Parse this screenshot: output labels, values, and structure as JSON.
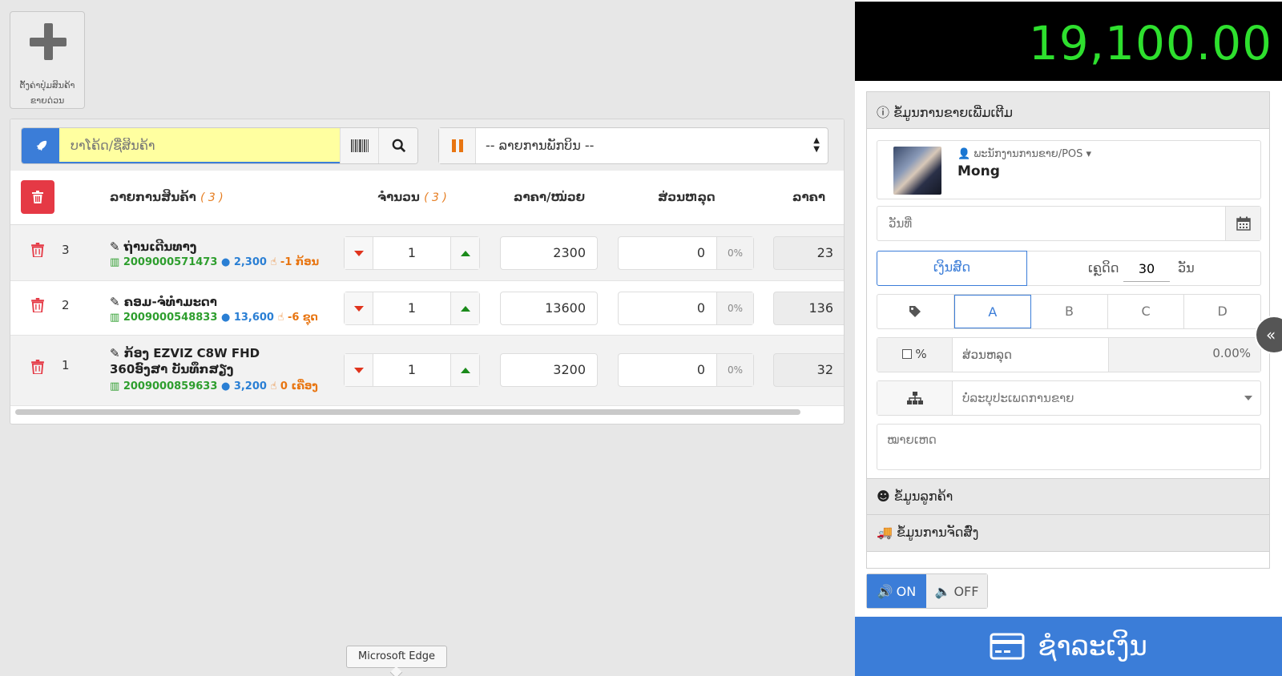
{
  "add_button": {
    "label": "ຕັ້ງຄ່າປຸ່ມສິນຄ້າຂາຍດ່ວນ"
  },
  "search": {
    "placeholder": "ບາໂຄ້ດ/ຊື່ສິນຄ້າ"
  },
  "hold": {
    "selected": "-- ລາຍການພັກບິນ --"
  },
  "table": {
    "headers": {
      "item": "ລາຍການສິນຄ້າ",
      "item_count": "( 3 )",
      "qty": "ຈຳນວນ",
      "qty_count": "( 3 )",
      "unit_price": "ລາຄາ/ໜ່ວຍ",
      "discount": "ສ່ວນຫລຸດ",
      "total": "ລາຄາ"
    },
    "rows": [
      {
        "index": "3",
        "name": "ຖ່ານເດີນທາງ",
        "barcode": "2009000571473",
        "price": "2,300",
        "stock": "-1 ກ້ອນ",
        "qty": "1",
        "unit_price": "2300",
        "discount": "0",
        "discount_pct": "0%",
        "total": "23"
      },
      {
        "index": "2",
        "name": "ຄອມ-ຈໍທຳມະດາ",
        "barcode": "2009000548833",
        "price": "13,600",
        "stock": "-6 ຊຸດ",
        "qty": "1",
        "unit_price": "13600",
        "discount": "0",
        "discount_pct": "0%",
        "total": "136"
      },
      {
        "index": "1",
        "name": "ກ້ອງ EZVIZ C8W FHD 360ອົງສາ ບັນທຶກສຽງ",
        "barcode": "2009000859633",
        "price": "3,200",
        "stock": "0 ເຄື່ອງ",
        "qty": "1",
        "unit_price": "3200",
        "discount": "0",
        "discount_pct": "0%",
        "total": "32"
      }
    ]
  },
  "tooltip": {
    "text": "Microsoft Edge"
  },
  "total_display": {
    "amount": "19,100.00"
  },
  "sale_info": {
    "title": "ຂໍ້ມູນການຂາຍເພີ່ມເຕີມ",
    "employee_label": "ພະນັກງານການຂາຍ/POS",
    "employee_name": "Mong",
    "date_placeholder": "ວັນທີ່",
    "credit_button": "ເງິນສົດ",
    "credit_term_label": "ເຄຼດິດ",
    "credit_days": "30",
    "credit_days_unit": "ວັນ",
    "price_levels": [
      "A",
      "B",
      "C",
      "D"
    ],
    "active_price_level": "A",
    "percent_label": "%",
    "discount_label": "ສ່ວນຫລຸດ",
    "discount_value": "0.00%",
    "sale_type_placeholder": "ບໍ່ລະບຸປະເພດການຂາຍ",
    "note_placeholder": "ໝາຍເຫດ"
  },
  "customer": {
    "title": "ຂໍ້ມູນລູກຄ້າ"
  },
  "delivery": {
    "title": "ຂໍ້ມູນການຈັດສົ່ງ"
  },
  "sound": {
    "on": "ON",
    "off": "OFF"
  },
  "pay": {
    "label": "ຊຳລະເງິນ"
  },
  "colors": {
    "accent": "#3b7dd8",
    "total_green": "#2ee02e",
    "danger": "#e53945",
    "barcode": "#2e9e2e",
    "price": "#2a7fd4",
    "stock": "#e87511"
  }
}
